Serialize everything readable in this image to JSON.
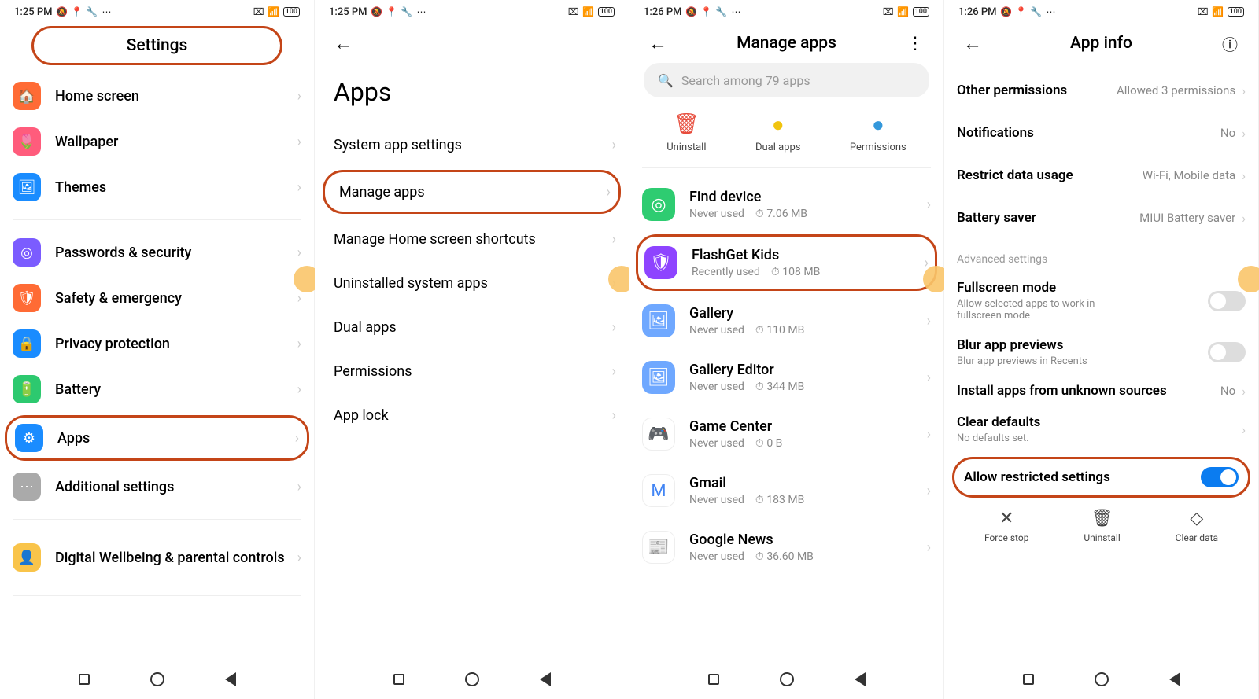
{
  "status": {
    "time1": "1:25 PM",
    "time2": "1:26 PM",
    "battery": "100"
  },
  "s1": {
    "title": "Settings",
    "items": [
      {
        "icon": "🏠",
        "bg": "#ff6b35",
        "label": "Home screen"
      },
      {
        "icon": "🌷",
        "bg": "#ff5c7c",
        "label": "Wallpaper"
      },
      {
        "icon": "🖼",
        "bg": "#1a8cff",
        "label": "Themes"
      }
    ],
    "items2": [
      {
        "icon": "◎",
        "bg": "#7b5cff",
        "label": "Passwords & security"
      },
      {
        "icon": "🛡",
        "bg": "#ff6b35",
        "label": "Safety & emergency"
      },
      {
        "icon": "🔒",
        "bg": "#1a8cff",
        "label": "Privacy protection"
      },
      {
        "icon": "🔋",
        "bg": "#2dc96f",
        "label": "Battery"
      },
      {
        "icon": "⚙",
        "bg": "#1a8cff",
        "label": "Apps"
      },
      {
        "icon": "⋯",
        "bg": "#aaa",
        "label": "Additional settings"
      }
    ],
    "items3": [
      {
        "icon": "👤",
        "bg": "#f9c44a",
        "label": "Digital Wellbeing & parental controls"
      }
    ]
  },
  "s2": {
    "title": "Apps",
    "items": [
      "System app settings",
      "Manage apps",
      "Manage Home screen shortcuts",
      "Uninstalled system apps",
      "Dual apps",
      "Permissions",
      "App lock"
    ]
  },
  "s3": {
    "title": "Manage apps",
    "search": "Search among 79 apps",
    "actions": [
      {
        "label": "Uninstall",
        "icon": "🗑",
        "color": "#e74c3c"
      },
      {
        "label": "Dual apps",
        "icon": "●",
        "color": "#f1c40f"
      },
      {
        "label": "Permissions",
        "icon": "●",
        "color": "#3498db"
      }
    ],
    "apps": [
      {
        "name": "Find device",
        "usage": "Never used",
        "size": "7.06 MB",
        "bg": "#2ecc71",
        "icon": "◎"
      },
      {
        "name": "FlashGet Kids",
        "usage": "Recently used",
        "size": "108 MB",
        "bg": "#8e44ff",
        "icon": "🛡"
      },
      {
        "name": "Gallery",
        "usage": "Never used",
        "size": "110 MB",
        "bg": "#6fa8ff",
        "icon": "🖼"
      },
      {
        "name": "Gallery Editor",
        "usage": "Never used",
        "size": "344 MB",
        "bg": "#6fa8ff",
        "icon": "🖼"
      },
      {
        "name": "Game Center",
        "usage": "Never used",
        "size": "0 B",
        "bg": "#fff",
        "icon": "🎮"
      },
      {
        "name": "Gmail",
        "usage": "Never used",
        "size": "183 MB",
        "bg": "#fff",
        "icon": "M"
      },
      {
        "name": "Google News",
        "usage": "Never used",
        "size": "36.60 MB",
        "bg": "#fff",
        "icon": "📰"
      }
    ]
  },
  "s4": {
    "title": "App info",
    "rows": [
      {
        "label": "Other permissions",
        "value": "Allowed 3 permissions"
      },
      {
        "label": "Notifications",
        "value": "No"
      },
      {
        "label": "Restrict data usage",
        "value": "Wi-Fi, Mobile data"
      },
      {
        "label": "Battery saver",
        "value": "MIUI Battery saver"
      }
    ],
    "section": "Advanced settings",
    "toggles": [
      {
        "label": "Fullscreen mode",
        "sub": "Allow selected apps to work in fullscreen mode",
        "on": false
      },
      {
        "label": "Blur app previews",
        "sub": "Blur app previews in Recents",
        "on": false
      }
    ],
    "install": {
      "label": "Install apps from unknown sources",
      "value": "No"
    },
    "clear": {
      "label": "Clear defaults",
      "sub": "No defaults set."
    },
    "allow": {
      "label": "Allow restricted settings",
      "on": true
    },
    "bactions": [
      {
        "icon": "✕",
        "label": "Force stop"
      },
      {
        "icon": "🗑",
        "label": "Uninstall"
      },
      {
        "icon": "◇",
        "label": "Clear data"
      }
    ]
  }
}
